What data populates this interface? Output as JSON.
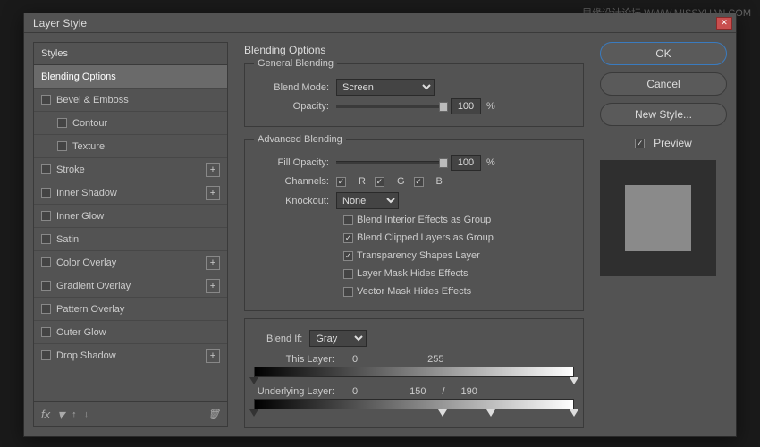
{
  "watermark": "思缘设计论坛  WWW.MISSYUAN.COM",
  "dialog_title": "Layer Style",
  "styles_header": "Styles",
  "styles": [
    {
      "label": "Blending Options",
      "checkbox": false,
      "selected": true,
      "plus": false,
      "indent": 0
    },
    {
      "label": "Bevel & Emboss",
      "checkbox": true,
      "selected": false,
      "plus": false,
      "indent": 0
    },
    {
      "label": "Contour",
      "checkbox": true,
      "selected": false,
      "plus": false,
      "indent": 1
    },
    {
      "label": "Texture",
      "checkbox": true,
      "selected": false,
      "plus": false,
      "indent": 1
    },
    {
      "label": "Stroke",
      "checkbox": true,
      "selected": false,
      "plus": true,
      "indent": 0
    },
    {
      "label": "Inner Shadow",
      "checkbox": true,
      "selected": false,
      "plus": true,
      "indent": 0
    },
    {
      "label": "Inner Glow",
      "checkbox": true,
      "selected": false,
      "plus": false,
      "indent": 0
    },
    {
      "label": "Satin",
      "checkbox": true,
      "selected": false,
      "plus": false,
      "indent": 0
    },
    {
      "label": "Color Overlay",
      "checkbox": true,
      "selected": false,
      "plus": true,
      "indent": 0
    },
    {
      "label": "Gradient Overlay",
      "checkbox": true,
      "selected": false,
      "plus": true,
      "indent": 0
    },
    {
      "label": "Pattern Overlay",
      "checkbox": true,
      "selected": false,
      "plus": false,
      "indent": 0
    },
    {
      "label": "Outer Glow",
      "checkbox": true,
      "selected": false,
      "plus": false,
      "indent": 0
    },
    {
      "label": "Drop Shadow",
      "checkbox": true,
      "selected": false,
      "plus": true,
      "indent": 0
    }
  ],
  "fx_label": "fx",
  "main": {
    "title": "Blending Options",
    "general": {
      "legend": "General Blending",
      "blend_mode_label": "Blend Mode:",
      "blend_mode_value": "Screen",
      "opacity_label": "Opacity:",
      "opacity_value": "100",
      "pct": "%"
    },
    "advanced": {
      "legend": "Advanced Blending",
      "fill_label": "Fill Opacity:",
      "fill_value": "100",
      "channels_label": "Channels:",
      "ch_r": "R",
      "ch_g": "G",
      "ch_b": "B",
      "knockout_label": "Knockout:",
      "knockout_value": "None",
      "opt1": "Blend Interior Effects as Group",
      "opt2": "Blend Clipped Layers as Group",
      "opt3": "Transparency Shapes Layer",
      "opt4": "Layer Mask Hides Effects",
      "opt5": "Vector Mask Hides Effects"
    },
    "blendif": {
      "label": "Blend If:",
      "value": "Gray",
      "this_layer_label": "This Layer:",
      "this_v1": "0",
      "this_v2": "255",
      "under_label": "Underlying Layer:",
      "under_v1": "0",
      "under_v2": "150",
      "slash": "/",
      "under_v3": "190"
    }
  },
  "right": {
    "ok": "OK",
    "cancel": "Cancel",
    "new_style": "New Style...",
    "preview": "Preview"
  }
}
